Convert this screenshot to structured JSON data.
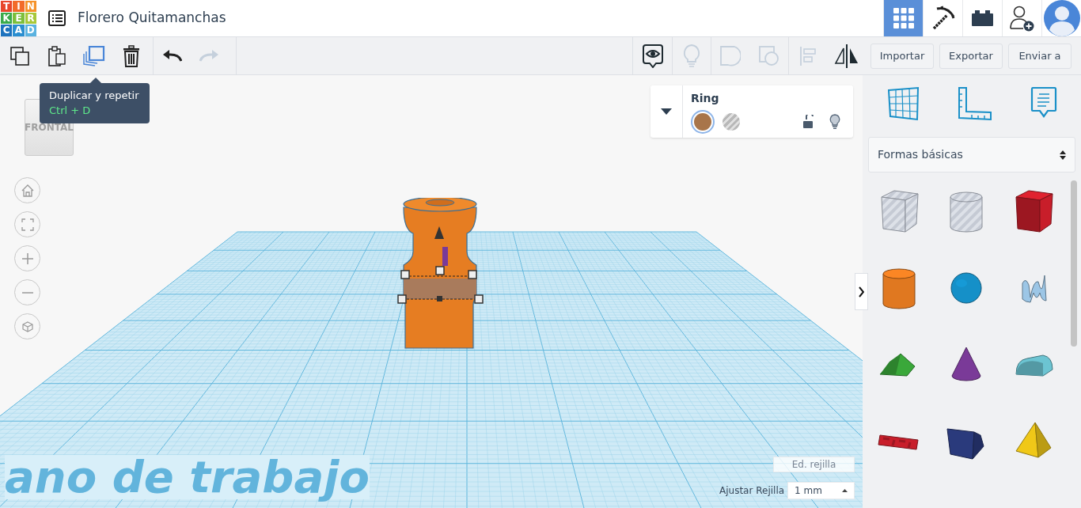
{
  "logo": [
    {
      "letter": "T",
      "color": "#e8472b"
    },
    {
      "letter": "I",
      "color": "#f26b2a"
    },
    {
      "letter": "N",
      "color": "#f5922a"
    },
    {
      "letter": "K",
      "color": "#3aaa4a"
    },
    {
      "letter": "E",
      "color": "#7cbf3c"
    },
    {
      "letter": "R",
      "color": "#a8c83a"
    },
    {
      "letter": "C",
      "color": "#1e73be"
    },
    {
      "letter": "A",
      "color": "#2a8ed0"
    },
    {
      "letter": "D",
      "color": "#5ab2e0"
    }
  ],
  "title": "Florero Quitamanchas",
  "nav": [
    {
      "kind": "grid",
      "selected": true
    },
    {
      "kind": "pickaxe",
      "selected": false
    },
    {
      "kind": "brick",
      "selected": false
    },
    {
      "kind": "add-user",
      "selected": false
    },
    {
      "kind": "avatar",
      "selected": false
    }
  ],
  "toolbar_left": [
    {
      "kind": "copy",
      "disabled": false,
      "hovered": false
    },
    {
      "kind": "paste",
      "disabled": false,
      "hovered": false
    },
    {
      "kind": "duplicate",
      "disabled": false,
      "hovered": true
    },
    {
      "kind": "delete",
      "disabled": false,
      "hovered": false
    },
    {
      "kind": "undo",
      "disabled": false,
      "hovered": false
    },
    {
      "kind": "redo",
      "disabled": true,
      "hovered": false
    }
  ],
  "toolbar_right": [
    {
      "kind": "show-all",
      "disabled": false
    },
    {
      "kind": "bulb",
      "disabled": true
    },
    {
      "kind": "group",
      "disabled": true
    },
    {
      "kind": "ungroup",
      "disabled": true
    },
    {
      "kind": "align",
      "disabled": true
    },
    {
      "kind": "mirror",
      "disabled": false
    }
  ],
  "actions": [
    "Importar",
    "Exportar",
    "Enviar a"
  ],
  "tooltip": {
    "title": "Duplicar y repetir",
    "shortcut": "Ctrl + D"
  },
  "view_cube": {
    "label": "FRONTAL"
  },
  "inspector": {
    "name": "Ring",
    "swatches": [
      {
        "kind": "solid",
        "color": "#a8754a",
        "selected": true
      },
      {
        "kind": "hole",
        "color": "#b8b8b8",
        "selected": false
      }
    ],
    "locked": false
  },
  "workplane_label": "ano de trabajo",
  "grid": {
    "edit": "Ed. rejilla",
    "snap_label": "Ajustar Rejilla",
    "snap_value": "1 mm"
  },
  "library": {
    "category": "Formas básicas",
    "shapes": [
      {
        "kind": "box",
        "color": "#c5cad4",
        "hole": true
      },
      {
        "kind": "cylinder",
        "color": "#c5cad4",
        "hole": true
      },
      {
        "kind": "box",
        "color": "#c81e2a",
        "hole": false
      },
      {
        "kind": "cylinder",
        "color": "#e07820",
        "hole": false
      },
      {
        "kind": "sphere",
        "color": "#1590c8",
        "hole": false
      },
      {
        "kind": "scribble",
        "color": "#9cc6e6",
        "hole": false
      },
      {
        "kind": "wedge",
        "color": "#3aa83a",
        "hole": false
      },
      {
        "kind": "cone",
        "color": "#7a3a98",
        "hole": false
      },
      {
        "kind": "half-cylinder",
        "color": "#6cc4d2",
        "hole": false
      },
      {
        "kind": "text-block",
        "color": "#c81e2a",
        "hole": false
      },
      {
        "kind": "prism",
        "color": "#2a3a7c",
        "hole": false
      },
      {
        "kind": "pyramid",
        "color": "#f0c818",
        "hole": false
      }
    ]
  }
}
